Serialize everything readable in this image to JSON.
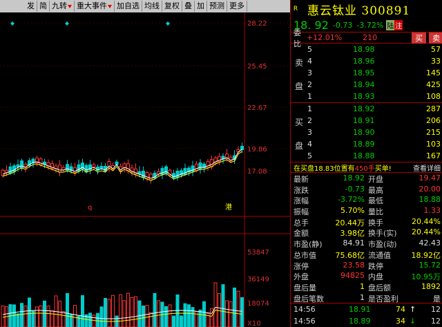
{
  "toolbar": {
    "items": [
      {
        "label": "发",
        "arrow": false
      },
      {
        "label": "简",
        "arrow": false
      },
      {
        "label": "九转",
        "arrow": true
      },
      {
        "label": "重大事件",
        "arrow": true
      },
      {
        "label": "加自选",
        "arrow": false
      },
      {
        "label": "均线",
        "arrow": false
      },
      {
        "label": "复权",
        "arrow": false
      },
      {
        "label": "叠",
        "arrow": false
      },
      {
        "label": "加",
        "arrow": false
      },
      {
        "label": "预测",
        "arrow": false
      },
      {
        "label": "更多",
        "arrow": false
      }
    ]
  },
  "chart_data": {
    "type": "candlestick",
    "price_axis_ticks": [
      "28.22",
      "25.45",
      "22.67",
      "19.86",
      "17.08"
    ],
    "volume_axis_ticks": [
      "53847",
      "36149",
      "18074",
      "X10"
    ],
    "annotations": [
      "q",
      "港"
    ],
    "colors": {
      "up": "#ff3333",
      "down": "#00cccc",
      "ma_white": "#ffffff",
      "ma_yellow": "#ffff00"
    }
  },
  "stock": {
    "marker": "R",
    "name_code": "惠云钛业 300891",
    "price": "18. 92",
    "change": "-0.73",
    "change_pct": "-3.72%",
    "tag_lutong": "陆",
    "tag_zhu": "注"
  },
  "weibi": {
    "label": "委比",
    "ratio": "+12.01%",
    "diff": "210",
    "buy_btn": "买",
    "sell_btn": "卖"
  },
  "orderbook": {
    "sell": [
      {
        "side": "",
        "level": "5",
        "price": "18.98",
        "vol": "57"
      },
      {
        "side": "卖",
        "level": "4",
        "price": "18.96",
        "vol": "33"
      },
      {
        "side": "",
        "level": "3",
        "price": "18.95",
        "vol": "145"
      },
      {
        "side": "盘",
        "level": "2",
        "price": "18.94",
        "vol": "425"
      },
      {
        "side": "",
        "level": "1",
        "price": "18.93",
        "vol": "108"
      }
    ],
    "buy": [
      {
        "side": "",
        "level": "1",
        "price": "18.92",
        "vol": "287"
      },
      {
        "side": "买",
        "level": "2",
        "price": "18.91",
        "vol": "206"
      },
      {
        "side": "",
        "level": "3",
        "price": "18.90",
        "vol": "215"
      },
      {
        "side": "盘",
        "level": "4",
        "price": "18.89",
        "vol": "103"
      },
      {
        "side": "",
        "level": "5",
        "price": "18.88",
        "vol": "167"
      }
    ]
  },
  "info_bar": {
    "text_a": "在买盘18.83位置有",
    "text_b": "450手",
    "text_c": "买单!",
    "link": "查看详细"
  },
  "stats": [
    {
      "l1": "最新",
      "v1": "18.92",
      "c1": "g",
      "l2": "开盘",
      "v2": "19.47",
      "c2": "rd"
    },
    {
      "l1": "涨跌",
      "v1": "-0.73",
      "c1": "g",
      "l2": "最高",
      "v2": "20.00",
      "c2": "rd"
    },
    {
      "l1": "涨幅",
      "v1": "-3.72%",
      "c1": "g",
      "l2": "最低",
      "v2": "18.88",
      "c2": "g"
    },
    {
      "l1": "振幅",
      "v1": "5.70%",
      "c1": "y",
      "l2": "量比",
      "v2": "1.33",
      "c2": "rd"
    },
    {
      "l1": "总手",
      "v1": "20.44万",
      "c1": "y",
      "l2": "换手",
      "v2": "20.44%",
      "c2": "y"
    },
    {
      "l1": "金额",
      "v1": "3.98亿",
      "c1": "y",
      "l2": "换手(实)",
      "v2": "20.44%",
      "c2": "y"
    },
    {
      "l1": "市盈(静)",
      "v1": "84.91",
      "c1": "w",
      "l2": "市盈(动)",
      "v2": "42.43",
      "c2": "w"
    },
    {
      "l1": "总市值",
      "v1": "75.68亿",
      "c1": "y",
      "l2": "流通值",
      "v2": "18.92亿",
      "c2": "y"
    },
    {
      "l1": "涨停",
      "v1": "23.58",
      "c1": "rd",
      "l2": "跌停",
      "v2": "15.72",
      "c2": "g"
    },
    {
      "l1": "外盘",
      "v1": "94825",
      "c1": "rd",
      "l2": "内盘",
      "v2": "10.95万",
      "c2": "g"
    },
    {
      "l1": "盘后量",
      "v1": "1",
      "c1": "y",
      "l2": "盘后额",
      "v2": "1892",
      "c2": "y"
    },
    {
      "l1": "盘后笔数",
      "v1": "1",
      "c1": "w",
      "l2": "是否盈利",
      "v2": "是",
      "c2": "w"
    }
  ],
  "ticks": [
    {
      "time": "14:56",
      "price": "18.91",
      "vol": "74",
      "dir": "up",
      "count": "12"
    },
    {
      "time": "14:56",
      "price": "18.89",
      "vol": "34",
      "dir": "down",
      "count": "12"
    }
  ]
}
